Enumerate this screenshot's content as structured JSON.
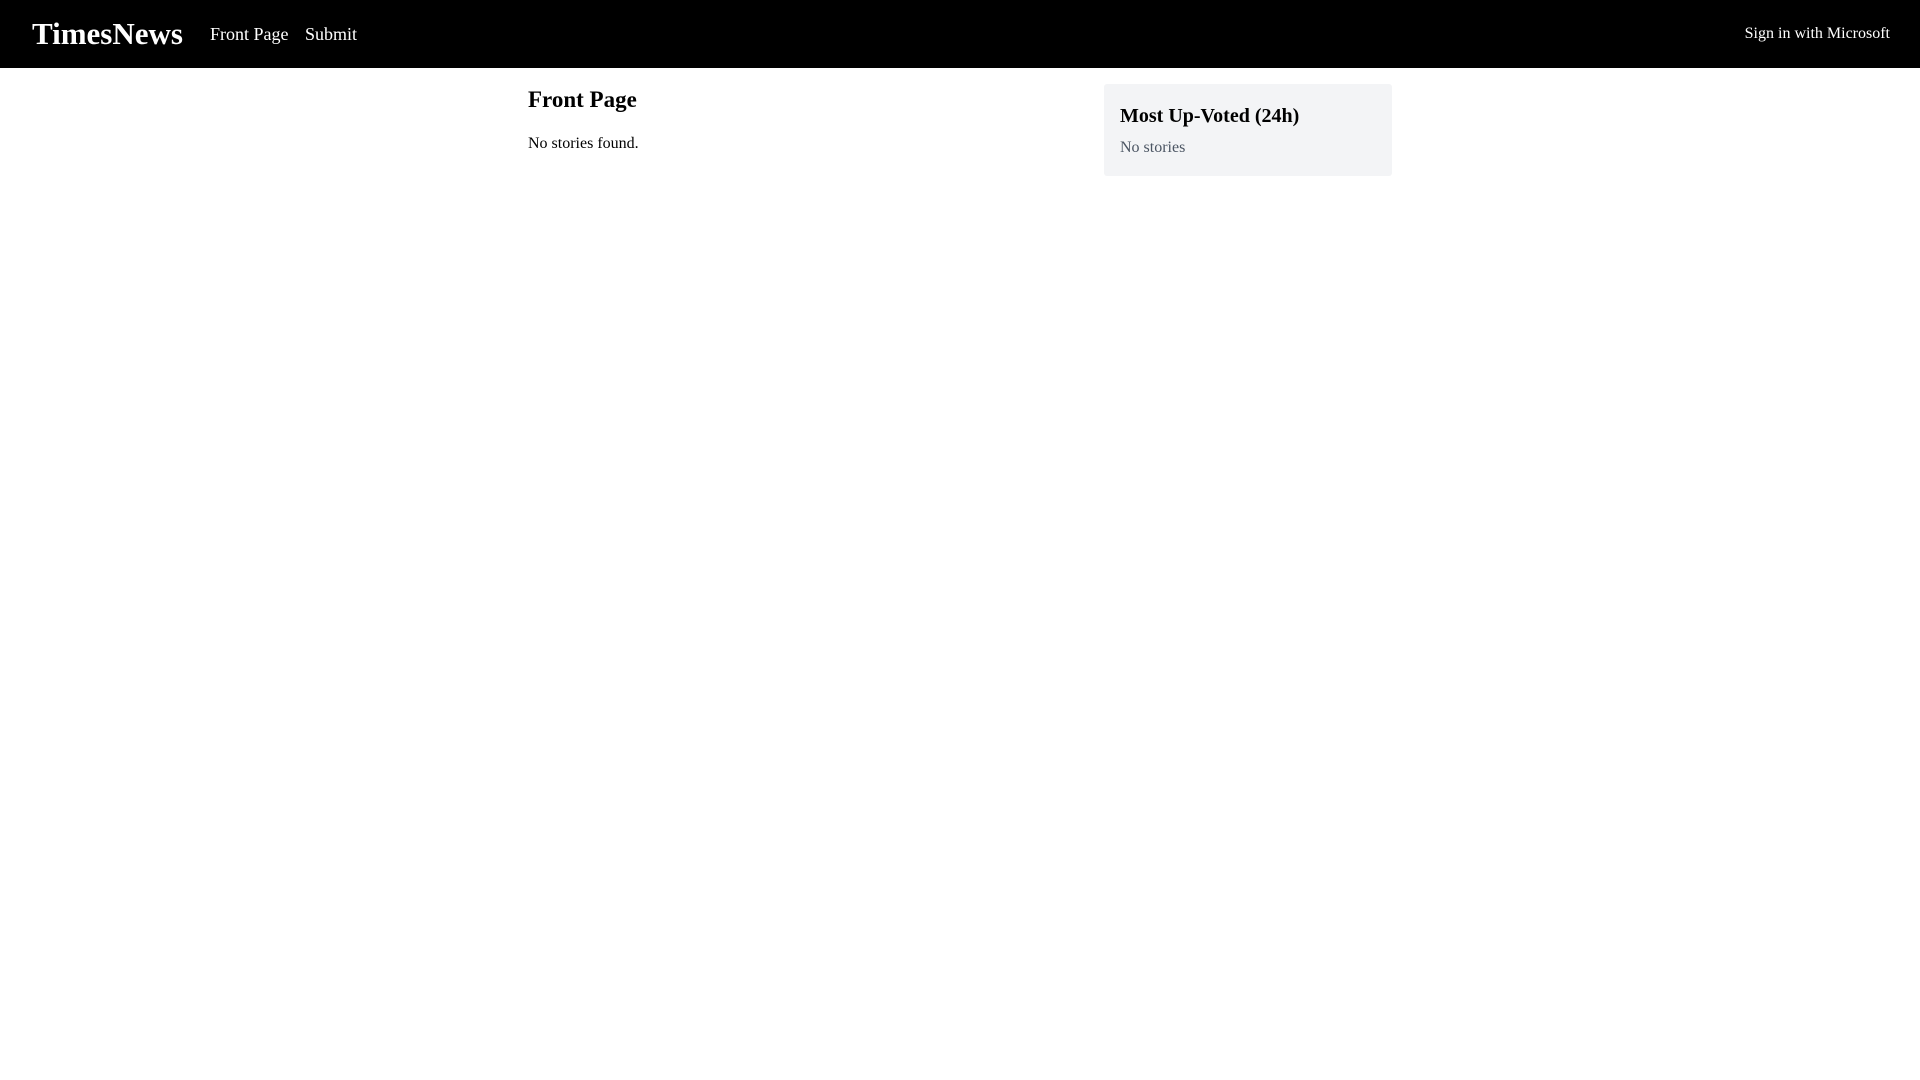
{
  "header": {
    "brand": "TimesNews",
    "nav": {
      "front_page": "Front Page",
      "submit": "Submit"
    },
    "sign_in": "Sign in with Microsoft"
  },
  "main": {
    "title": "Front Page",
    "empty_message": "No stories found."
  },
  "sidebar": {
    "title": "Most Up-Voted (24h)",
    "empty_message": "No stories"
  },
  "colors": {
    "header_background": "#000000",
    "header_text": "#ffffff",
    "sidebar_background": "#f3f4f6",
    "muted_text": "#4b5563"
  }
}
